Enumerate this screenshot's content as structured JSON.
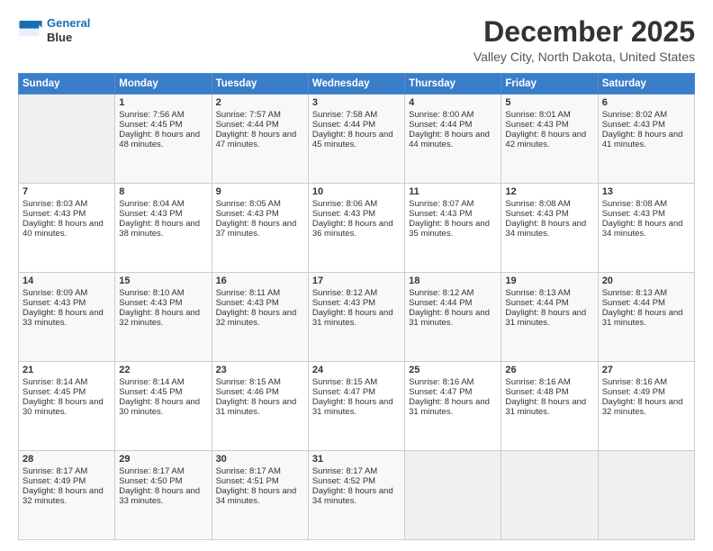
{
  "logo": {
    "line1": "General",
    "line2": "Blue"
  },
  "header": {
    "title": "December 2025",
    "subtitle": "Valley City, North Dakota, United States"
  },
  "weekdays": [
    "Sunday",
    "Monday",
    "Tuesday",
    "Wednesday",
    "Thursday",
    "Friday",
    "Saturday"
  ],
  "weeks": [
    [
      {
        "day": "",
        "sunrise": "",
        "sunset": "",
        "daylight": ""
      },
      {
        "day": "1",
        "sunrise": "Sunrise: 7:56 AM",
        "sunset": "Sunset: 4:45 PM",
        "daylight": "Daylight: 8 hours and 48 minutes."
      },
      {
        "day": "2",
        "sunrise": "Sunrise: 7:57 AM",
        "sunset": "Sunset: 4:44 PM",
        "daylight": "Daylight: 8 hours and 47 minutes."
      },
      {
        "day": "3",
        "sunrise": "Sunrise: 7:58 AM",
        "sunset": "Sunset: 4:44 PM",
        "daylight": "Daylight: 8 hours and 45 minutes."
      },
      {
        "day": "4",
        "sunrise": "Sunrise: 8:00 AM",
        "sunset": "Sunset: 4:44 PM",
        "daylight": "Daylight: 8 hours and 44 minutes."
      },
      {
        "day": "5",
        "sunrise": "Sunrise: 8:01 AM",
        "sunset": "Sunset: 4:43 PM",
        "daylight": "Daylight: 8 hours and 42 minutes."
      },
      {
        "day": "6",
        "sunrise": "Sunrise: 8:02 AM",
        "sunset": "Sunset: 4:43 PM",
        "daylight": "Daylight: 8 hours and 41 minutes."
      }
    ],
    [
      {
        "day": "7",
        "sunrise": "Sunrise: 8:03 AM",
        "sunset": "Sunset: 4:43 PM",
        "daylight": "Daylight: 8 hours and 40 minutes."
      },
      {
        "day": "8",
        "sunrise": "Sunrise: 8:04 AM",
        "sunset": "Sunset: 4:43 PM",
        "daylight": "Daylight: 8 hours and 38 minutes."
      },
      {
        "day": "9",
        "sunrise": "Sunrise: 8:05 AM",
        "sunset": "Sunset: 4:43 PM",
        "daylight": "Daylight: 8 hours and 37 minutes."
      },
      {
        "day": "10",
        "sunrise": "Sunrise: 8:06 AM",
        "sunset": "Sunset: 4:43 PM",
        "daylight": "Daylight: 8 hours and 36 minutes."
      },
      {
        "day": "11",
        "sunrise": "Sunrise: 8:07 AM",
        "sunset": "Sunset: 4:43 PM",
        "daylight": "Daylight: 8 hours and 35 minutes."
      },
      {
        "day": "12",
        "sunrise": "Sunrise: 8:08 AM",
        "sunset": "Sunset: 4:43 PM",
        "daylight": "Daylight: 8 hours and 34 minutes."
      },
      {
        "day": "13",
        "sunrise": "Sunrise: 8:08 AM",
        "sunset": "Sunset: 4:43 PM",
        "daylight": "Daylight: 8 hours and 34 minutes."
      }
    ],
    [
      {
        "day": "14",
        "sunrise": "Sunrise: 8:09 AM",
        "sunset": "Sunset: 4:43 PM",
        "daylight": "Daylight: 8 hours and 33 minutes."
      },
      {
        "day": "15",
        "sunrise": "Sunrise: 8:10 AM",
        "sunset": "Sunset: 4:43 PM",
        "daylight": "Daylight: 8 hours and 32 minutes."
      },
      {
        "day": "16",
        "sunrise": "Sunrise: 8:11 AM",
        "sunset": "Sunset: 4:43 PM",
        "daylight": "Daylight: 8 hours and 32 minutes."
      },
      {
        "day": "17",
        "sunrise": "Sunrise: 8:12 AM",
        "sunset": "Sunset: 4:43 PM",
        "daylight": "Daylight: 8 hours and 31 minutes."
      },
      {
        "day": "18",
        "sunrise": "Sunrise: 8:12 AM",
        "sunset": "Sunset: 4:44 PM",
        "daylight": "Daylight: 8 hours and 31 minutes."
      },
      {
        "day": "19",
        "sunrise": "Sunrise: 8:13 AM",
        "sunset": "Sunset: 4:44 PM",
        "daylight": "Daylight: 8 hours and 31 minutes."
      },
      {
        "day": "20",
        "sunrise": "Sunrise: 8:13 AM",
        "sunset": "Sunset: 4:44 PM",
        "daylight": "Daylight: 8 hours and 31 minutes."
      }
    ],
    [
      {
        "day": "21",
        "sunrise": "Sunrise: 8:14 AM",
        "sunset": "Sunset: 4:45 PM",
        "daylight": "Daylight: 8 hours and 30 minutes."
      },
      {
        "day": "22",
        "sunrise": "Sunrise: 8:14 AM",
        "sunset": "Sunset: 4:45 PM",
        "daylight": "Daylight: 8 hours and 30 minutes."
      },
      {
        "day": "23",
        "sunrise": "Sunrise: 8:15 AM",
        "sunset": "Sunset: 4:46 PM",
        "daylight": "Daylight: 8 hours and 31 minutes."
      },
      {
        "day": "24",
        "sunrise": "Sunrise: 8:15 AM",
        "sunset": "Sunset: 4:47 PM",
        "daylight": "Daylight: 8 hours and 31 minutes."
      },
      {
        "day": "25",
        "sunrise": "Sunrise: 8:16 AM",
        "sunset": "Sunset: 4:47 PM",
        "daylight": "Daylight: 8 hours and 31 minutes."
      },
      {
        "day": "26",
        "sunrise": "Sunrise: 8:16 AM",
        "sunset": "Sunset: 4:48 PM",
        "daylight": "Daylight: 8 hours and 31 minutes."
      },
      {
        "day": "27",
        "sunrise": "Sunrise: 8:16 AM",
        "sunset": "Sunset: 4:49 PM",
        "daylight": "Daylight: 8 hours and 32 minutes."
      }
    ],
    [
      {
        "day": "28",
        "sunrise": "Sunrise: 8:17 AM",
        "sunset": "Sunset: 4:49 PM",
        "daylight": "Daylight: 8 hours and 32 minutes."
      },
      {
        "day": "29",
        "sunrise": "Sunrise: 8:17 AM",
        "sunset": "Sunset: 4:50 PM",
        "daylight": "Daylight: 8 hours and 33 minutes."
      },
      {
        "day": "30",
        "sunrise": "Sunrise: 8:17 AM",
        "sunset": "Sunset: 4:51 PM",
        "daylight": "Daylight: 8 hours and 34 minutes."
      },
      {
        "day": "31",
        "sunrise": "Sunrise: 8:17 AM",
        "sunset": "Sunset: 4:52 PM",
        "daylight": "Daylight: 8 hours and 34 minutes."
      },
      {
        "day": "",
        "sunrise": "",
        "sunset": "",
        "daylight": ""
      },
      {
        "day": "",
        "sunrise": "",
        "sunset": "",
        "daylight": ""
      },
      {
        "day": "",
        "sunrise": "",
        "sunset": "",
        "daylight": ""
      }
    ]
  ]
}
